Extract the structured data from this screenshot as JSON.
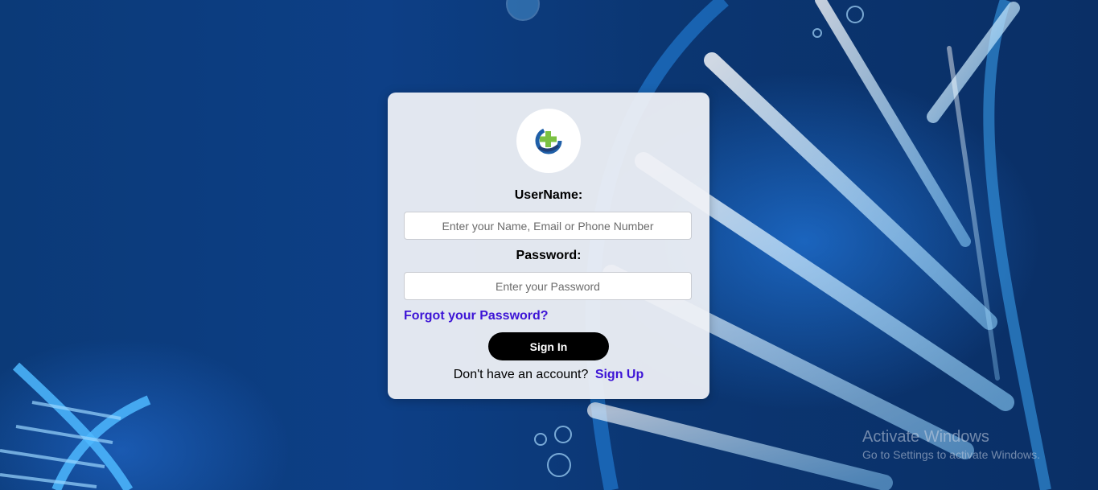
{
  "login": {
    "username_label": "UserName:",
    "username_placeholder": "Enter your Name, Email or Phone Number",
    "password_label": "Password:",
    "password_placeholder": "Enter your Password",
    "forgot_label": "Forgot your Password?",
    "signin_label": "Sign In",
    "signup_prompt": "Don't have an account?",
    "signup_label": "Sign Up"
  },
  "icons": {
    "logo": "medical-cross-logo-icon"
  },
  "watermark": {
    "title": "Activate Windows",
    "subtitle": "Go to Settings to activate Windows."
  },
  "colors": {
    "link": "#3d14d6",
    "button": "#000000",
    "background": "#0b3a78"
  }
}
